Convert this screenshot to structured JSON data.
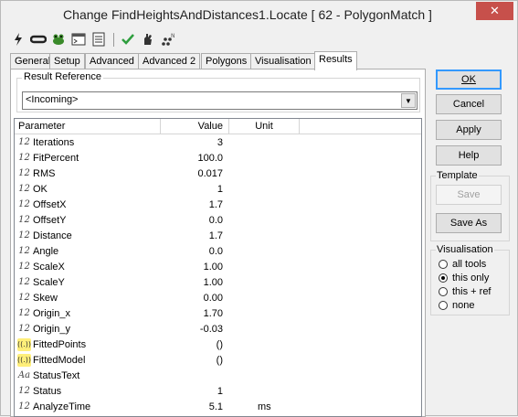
{
  "window": {
    "title": "Change FindHeightsAndDistances1.Locate [ 62 - PolygonMatch ]",
    "close_glyph": "✕"
  },
  "toolbar": {
    "icons": [
      "lightning-icon",
      "link-icon",
      "frog-icon",
      "console-icon",
      "notes-icon",
      "check-icon",
      "hand-icon",
      "points-icon"
    ]
  },
  "tabs": [
    "General",
    "Setup",
    "Advanced",
    "Advanced 2",
    "Polygons",
    "Visualisation",
    "Results"
  ],
  "active_tab": "Results",
  "result_reference": {
    "label": "Result Reference",
    "value": "<Incoming>"
  },
  "grid": {
    "headers": {
      "parameter": "Parameter",
      "value": "Value",
      "unit": "Unit"
    },
    "rows": [
      {
        "icon": "12",
        "type": "number",
        "name": "Iterations",
        "value": "3",
        "unit": ""
      },
      {
        "icon": "12",
        "type": "number",
        "name": "FitPercent",
        "value": "100.0",
        "unit": ""
      },
      {
        "icon": "12",
        "type": "number",
        "name": "RMS",
        "value": "0.017",
        "unit": ""
      },
      {
        "icon": "12",
        "type": "number",
        "name": "OK",
        "value": "1",
        "unit": ""
      },
      {
        "icon": "12",
        "type": "number",
        "name": "OffsetX",
        "value": "1.7",
        "unit": ""
      },
      {
        "icon": "12",
        "type": "number",
        "name": "OffsetY",
        "value": "0.0",
        "unit": ""
      },
      {
        "icon": "12",
        "type": "number",
        "name": "Distance",
        "value": "1.7",
        "unit": ""
      },
      {
        "icon": "12",
        "type": "number",
        "name": "Angle",
        "value": "0.0",
        "unit": ""
      },
      {
        "icon": "12",
        "type": "number",
        "name": "ScaleX",
        "value": "1.00",
        "unit": ""
      },
      {
        "icon": "12",
        "type": "number",
        "name": "ScaleY",
        "value": "1.00",
        "unit": ""
      },
      {
        "icon": "12",
        "type": "number",
        "name": "Skew",
        "value": "0.00",
        "unit": ""
      },
      {
        "icon": "12",
        "type": "number",
        "name": "Origin_x",
        "value": "1.70",
        "unit": ""
      },
      {
        "icon": "12",
        "type": "number",
        "name": "Origin_y",
        "value": "-0.03",
        "unit": ""
      },
      {
        "icon": "((.))",
        "type": "list",
        "name": "FittedPoints",
        "value": "()",
        "unit": ""
      },
      {
        "icon": "((.))",
        "type": "list",
        "name": "FittedModel",
        "value": "()",
        "unit": ""
      },
      {
        "icon": "Aa",
        "type": "text",
        "name": "StatusText",
        "value": "",
        "unit": ""
      },
      {
        "icon": "12",
        "type": "number",
        "name": "Status",
        "value": "1",
        "unit": ""
      },
      {
        "icon": "12",
        "type": "number",
        "name": "AnalyzeTime",
        "value": "5.1",
        "unit": "ms"
      }
    ]
  },
  "buttons": {
    "ok": "OK",
    "cancel": "Cancel",
    "apply": "Apply",
    "help": "Help"
  },
  "template": {
    "label": "Template",
    "save": "Save",
    "save_as": "Save As"
  },
  "visualisation": {
    "label": "Visualisation",
    "options": [
      {
        "label": "all tools",
        "checked": false
      },
      {
        "label": "this only",
        "checked": true
      },
      {
        "label": "this + ref",
        "checked": false
      },
      {
        "label": "none",
        "checked": false
      }
    ]
  }
}
